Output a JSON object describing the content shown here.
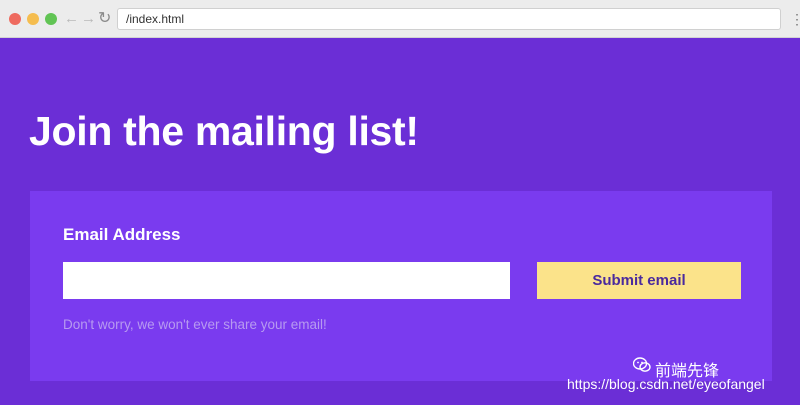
{
  "browser": {
    "url": "/index.html",
    "back_icon": "←",
    "forward_icon": "→",
    "reload_icon": "↻",
    "menu_icon": "⋮"
  },
  "page": {
    "title": "Join the mailing list!",
    "form": {
      "email_label": "Email Address",
      "email_value": "",
      "email_placeholder": "",
      "submit_label": "Submit email",
      "hint": "Don't worry, we won't ever share your email!"
    }
  },
  "watermark": {
    "brand": "前端先锋",
    "url": "https://blog.csdn.net/eyeofangel"
  },
  "colors": {
    "background": "#6b2ed6",
    "card": "#7a3bef",
    "button": "#fbe38a",
    "button_text": "#4a2a9e",
    "hint_text": "#b79af0"
  }
}
